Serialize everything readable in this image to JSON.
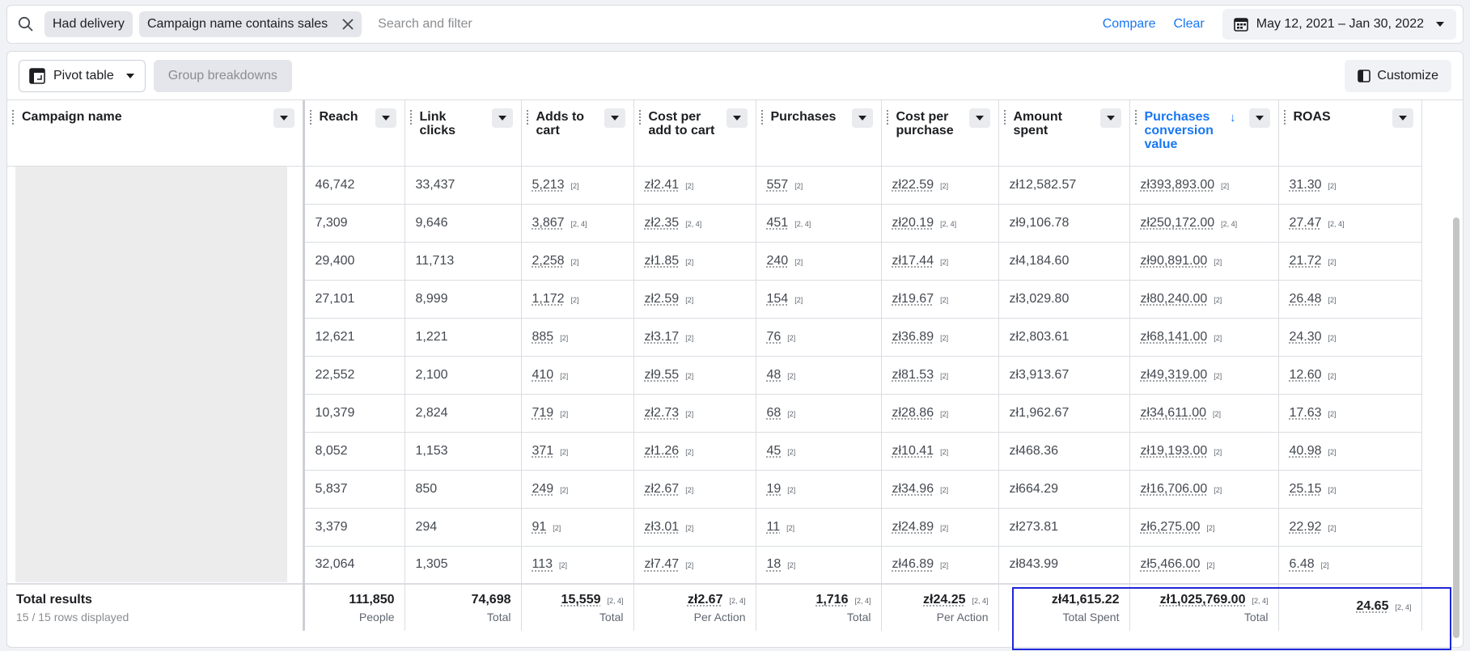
{
  "filters": {
    "chips": [
      {
        "label": "Had delivery",
        "removable": false
      },
      {
        "label": "Campaign name contains sales",
        "removable": true
      }
    ],
    "search_placeholder": "Search and filter",
    "compare_label": "Compare",
    "clear_label": "Clear",
    "date_range": "May 12, 2021 – Jan 30, 2022"
  },
  "toolbar": {
    "pivot_label": "Pivot table",
    "group_label": "Group breakdowns",
    "customize_label": "Customize"
  },
  "columns": [
    {
      "label": "Campaign name"
    },
    {
      "label": "Reach"
    },
    {
      "label": "Link clicks"
    },
    {
      "label": "Adds to cart"
    },
    {
      "label": "Cost per add to cart"
    },
    {
      "label": "Purchases"
    },
    {
      "label": "Cost per purchase"
    },
    {
      "label": "Amount spent"
    },
    {
      "label": "Purchases conversion value",
      "sorted": "desc"
    },
    {
      "label": "ROAS"
    }
  ],
  "rows": [
    {
      "reach": "46,742",
      "link_clicks": "33,437",
      "adds_to_cart": "5,213",
      "cost_per_atc": "zł2.41",
      "purchases": "557",
      "cost_per_purchase": "zł22.59",
      "amount_spent": "zł12,582.57",
      "conv_value": "zł393,893.00",
      "roas": "31.30",
      "ref": "[2]"
    },
    {
      "reach": "7,309",
      "link_clicks": "9,646",
      "adds_to_cart": "3,867",
      "cost_per_atc": "zł2.35",
      "purchases": "451",
      "cost_per_purchase": "zł20.19",
      "amount_spent": "zł9,106.78",
      "conv_value": "zł250,172.00",
      "roas": "27.47",
      "ref": "[2, 4]"
    },
    {
      "reach": "29,400",
      "link_clicks": "11,713",
      "adds_to_cart": "2,258",
      "cost_per_atc": "zł1.85",
      "purchases": "240",
      "cost_per_purchase": "zł17.44",
      "amount_spent": "zł4,184.60",
      "conv_value": "zł90,891.00",
      "roas": "21.72",
      "ref": "[2]"
    },
    {
      "reach": "27,101",
      "link_clicks": "8,999",
      "adds_to_cart": "1,172",
      "cost_per_atc": "zł2.59",
      "purchases": "154",
      "cost_per_purchase": "zł19.67",
      "amount_spent": "zł3,029.80",
      "conv_value": "zł80,240.00",
      "roas": "26.48",
      "ref": "[2]"
    },
    {
      "reach": "12,621",
      "link_clicks": "1,221",
      "adds_to_cart": "885",
      "cost_per_atc": "zł3.17",
      "purchases": "76",
      "cost_per_purchase": "zł36.89",
      "amount_spent": "zł2,803.61",
      "conv_value": "zł68,141.00",
      "roas": "24.30",
      "ref": "[2]"
    },
    {
      "reach": "22,552",
      "link_clicks": "2,100",
      "adds_to_cart": "410",
      "cost_per_atc": "zł9.55",
      "purchases": "48",
      "cost_per_purchase": "zł81.53",
      "amount_spent": "zł3,913.67",
      "conv_value": "zł49,319.00",
      "roas": "12.60",
      "ref": "[2]"
    },
    {
      "reach": "10,379",
      "link_clicks": "2,824",
      "adds_to_cart": "719",
      "cost_per_atc": "zł2.73",
      "purchases": "68",
      "cost_per_purchase": "zł28.86",
      "amount_spent": "zł1,962.67",
      "conv_value": "zł34,611.00",
      "roas": "17.63",
      "ref": "[2]"
    },
    {
      "reach": "8,052",
      "link_clicks": "1,153",
      "adds_to_cart": "371",
      "cost_per_atc": "zł1.26",
      "purchases": "45",
      "cost_per_purchase": "zł10.41",
      "amount_spent": "zł468.36",
      "conv_value": "zł19,193.00",
      "roas": "40.98",
      "ref": "[2]"
    },
    {
      "reach": "5,837",
      "link_clicks": "850",
      "adds_to_cart": "249",
      "cost_per_atc": "zł2.67",
      "purchases": "19",
      "cost_per_purchase": "zł34.96",
      "amount_spent": "zł664.29",
      "conv_value": "zł16,706.00",
      "roas": "25.15",
      "ref": "[2]"
    },
    {
      "reach": "3,379",
      "link_clicks": "294",
      "adds_to_cart": "91",
      "cost_per_atc": "zł3.01",
      "purchases": "11",
      "cost_per_purchase": "zł24.89",
      "amount_spent": "zł273.81",
      "conv_value": "zł6,275.00",
      "roas": "22.92",
      "ref": "[2]"
    },
    {
      "reach": "32,064",
      "link_clicks": "1,305",
      "adds_to_cart": "113",
      "cost_per_atc": "zł7.47",
      "purchases": "18",
      "cost_per_purchase": "zł46.89",
      "amount_spent": "zł843.99",
      "conv_value": "zł5,466.00",
      "roas": "6.48",
      "ref": "[2]"
    }
  ],
  "totals": {
    "label": "Total results",
    "rows_displayed": "15 / 15 rows displayed",
    "ref": "[2, 4]",
    "reach": {
      "value": "111,850",
      "sub": "People"
    },
    "link_clicks": {
      "value": "74,698",
      "sub": "Total"
    },
    "adds_to_cart": {
      "value": "15,559",
      "sub": "Total"
    },
    "cost_per_atc": {
      "value": "zł2.67",
      "sub": "Per Action"
    },
    "purchases": {
      "value": "1,716",
      "sub": "Total"
    },
    "cost_per_purchase": {
      "value": "zł24.25",
      "sub": "Per Action"
    },
    "amount_spent": {
      "value": "zł41,615.22",
      "sub": "Total Spent"
    },
    "conv_value": {
      "value": "zł1,025,769.00",
      "sub": "Total"
    },
    "roas": {
      "value": "24.65",
      "sub": ""
    }
  },
  "colors": {
    "accent": "#1877f2",
    "highlight_box": "#1e27d8"
  }
}
